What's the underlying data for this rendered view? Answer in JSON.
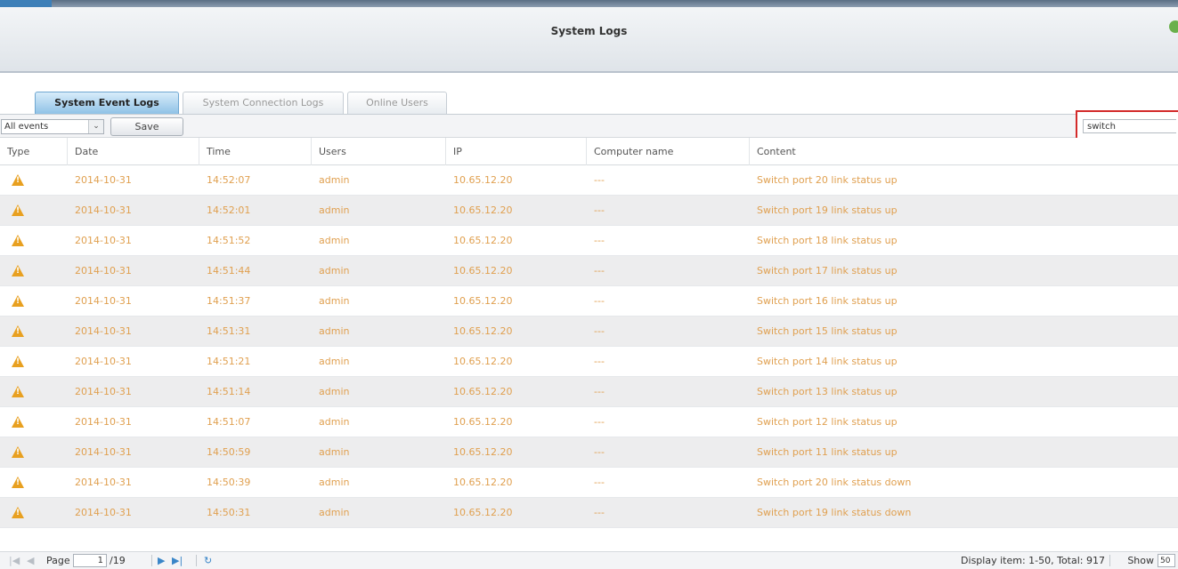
{
  "window": {
    "title": "System Logs"
  },
  "tabs": [
    {
      "label": "System Event Logs",
      "active": true
    },
    {
      "label": "System Connection Logs",
      "active": false
    },
    {
      "label": "Online Users",
      "active": false
    }
  ],
  "toolbar": {
    "filter_value": "All events",
    "save_label": "Save",
    "search_value": "switch"
  },
  "columns": [
    "Type",
    "Date",
    "Time",
    "Users",
    "IP",
    "Computer name",
    "Content"
  ],
  "rows": [
    {
      "type": "warning-icon",
      "date": "2014-10-31",
      "time": "14:52:07",
      "user": "admin",
      "ip": "10.65.12.20",
      "computer": "---",
      "content": "Switch port 20 link status up"
    },
    {
      "type": "warning-icon",
      "date": "2014-10-31",
      "time": "14:52:01",
      "user": "admin",
      "ip": "10.65.12.20",
      "computer": "---",
      "content": "Switch port 19 link status up"
    },
    {
      "type": "warning-icon",
      "date": "2014-10-31",
      "time": "14:51:52",
      "user": "admin",
      "ip": "10.65.12.20",
      "computer": "---",
      "content": "Switch port 18 link status up"
    },
    {
      "type": "warning-icon",
      "date": "2014-10-31",
      "time": "14:51:44",
      "user": "admin",
      "ip": "10.65.12.20",
      "computer": "---",
      "content": "Switch port 17 link status up"
    },
    {
      "type": "warning-icon",
      "date": "2014-10-31",
      "time": "14:51:37",
      "user": "admin",
      "ip": "10.65.12.20",
      "computer": "---",
      "content": "Switch port 16 link status up"
    },
    {
      "type": "warning-icon",
      "date": "2014-10-31",
      "time": "14:51:31",
      "user": "admin",
      "ip": "10.65.12.20",
      "computer": "---",
      "content": "Switch port 15 link status up"
    },
    {
      "type": "warning-icon",
      "date": "2014-10-31",
      "time": "14:51:21",
      "user": "admin",
      "ip": "10.65.12.20",
      "computer": "---",
      "content": "Switch port 14 link status up"
    },
    {
      "type": "warning-icon",
      "date": "2014-10-31",
      "time": "14:51:14",
      "user": "admin",
      "ip": "10.65.12.20",
      "computer": "---",
      "content": "Switch port 13 link status up"
    },
    {
      "type": "warning-icon",
      "date": "2014-10-31",
      "time": "14:51:07",
      "user": "admin",
      "ip": "10.65.12.20",
      "computer": "---",
      "content": "Switch port 12 link status up"
    },
    {
      "type": "warning-icon",
      "date": "2014-10-31",
      "time": "14:50:59",
      "user": "admin",
      "ip": "10.65.12.20",
      "computer": "---",
      "content": "Switch port 11 link status up"
    },
    {
      "type": "warning-icon",
      "date": "2014-10-31",
      "time": "14:50:39",
      "user": "admin",
      "ip": "10.65.12.20",
      "computer": "---",
      "content": "Switch port 20 link status down"
    },
    {
      "type": "warning-icon",
      "date": "2014-10-31",
      "time": "14:50:31",
      "user": "admin",
      "ip": "10.65.12.20",
      "computer": "---",
      "content": "Switch port 19 link status down"
    }
  ],
  "pagination": {
    "page_label": "Page",
    "current_page": "1",
    "total_pages": "/19",
    "display_text": "Display item: 1-50, Total: 917",
    "show_label": "Show",
    "show_value": "50"
  },
  "colors": {
    "warning": "#e8a020",
    "row_text": "#e0a050",
    "active_tab": "#8fc2e6",
    "search_highlight": "#d32a2a"
  }
}
